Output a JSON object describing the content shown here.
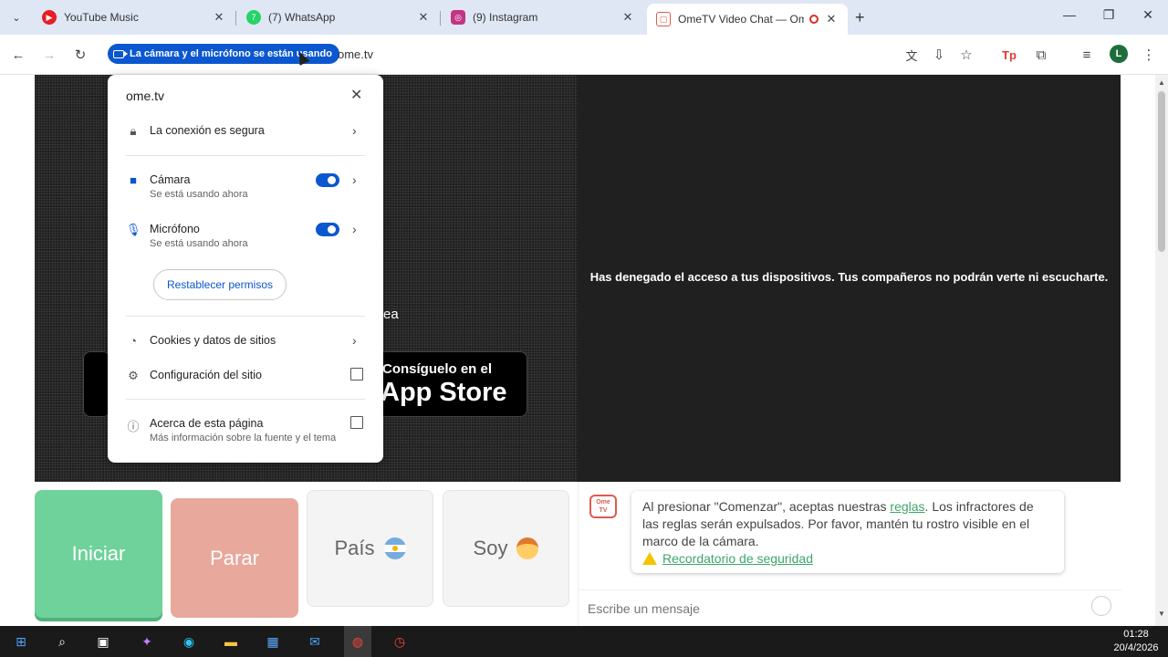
{
  "browser": {
    "tabs": [
      {
        "title": "YouTube Music",
        "icon": "youtube-music-icon",
        "color": "#e61e25"
      },
      {
        "title": "(7) WhatsApp",
        "icon": "whatsapp-icon",
        "color": "#25d366",
        "badge": "7"
      },
      {
        "title": "(9) Instagram",
        "icon": "instagram-icon",
        "color": "#c13584"
      },
      {
        "title": "OmeTV Video Chat — Ome",
        "icon": "ometv-icon",
        "color": "#e05a4f",
        "active": true
      }
    ],
    "permission_chip": "La cámara y el micrófono se están usando",
    "url": "ome.tv",
    "profile_initial": "L"
  },
  "site_popup": {
    "domain": "ome.tv",
    "connection": "La conexión es segura",
    "camera": {
      "label": "Cámara",
      "status": "Se está usando ahora",
      "enabled": true
    },
    "microphone": {
      "label": "Micrófono",
      "status": "Se está usando ahora",
      "enabled": true
    },
    "reset_button": "Restablecer permisos",
    "cookies": "Cookies y datos de sitios",
    "site_settings": "Configuración del sitio",
    "about": {
      "label": "Acerca de esta página",
      "sub": "Más información sobre la fuente y el tema"
    }
  },
  "page": {
    "partial_text": "ea",
    "app_store_small": "Consíguelo en el",
    "app_store_big": "App Store",
    "denied_message": "Has denegado el acceso a tus dispositivos. Tus compañeros no podrán verte ni escucharte.",
    "buttons": {
      "start": "Iniciar",
      "stop": "Parar",
      "country": "País",
      "me": "Soy"
    },
    "chat": {
      "logo_text_1": "Ome",
      "logo_text_2": "TV",
      "notice_before": "Al presionar \"Comenzar\", aceptas nuestras ",
      "notice_link": "reglas",
      "notice_after": ". Los infractores de las reglas serán expulsados. Por favor, mantén tu rostro visible en el marco de la cámara.",
      "safety_link": "Recordatorio de seguridad",
      "input_placeholder": "Escribe un mensaje"
    }
  },
  "taskbar": {
    "time": "01:28",
    "date": "20/4/2026"
  }
}
